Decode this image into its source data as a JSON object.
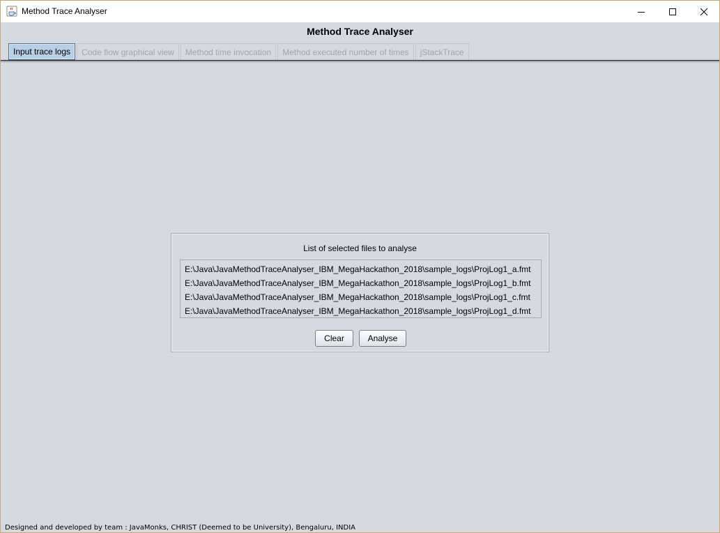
{
  "window": {
    "title": "Method Trace Analyser",
    "icon": "java-coffee-cup-icon",
    "controls": [
      "minimize-icon",
      "maximize-icon",
      "close-icon"
    ]
  },
  "app": {
    "heading": "Method Trace Analyser"
  },
  "tabs": [
    {
      "label": "Input trace logs",
      "active": true
    },
    {
      "label": "Code flow graphical view",
      "active": false
    },
    {
      "label": "Method time invocation",
      "active": false
    },
    {
      "label": "Method executed number of times",
      "active": false
    },
    {
      "label": "jStackTrace",
      "active": false
    }
  ],
  "panel": {
    "title": "List of selected files to analyse",
    "files": [
      "E:\\Java\\JavaMethodTraceAnalyser_IBM_MegaHackathon_2018\\sample_logs\\ProjLog1_a.fmt",
      "E:\\Java\\JavaMethodTraceAnalyser_IBM_MegaHackathon_2018\\sample_logs\\ProjLog1_b.fmt",
      "E:\\Java\\JavaMethodTraceAnalyser_IBM_MegaHackathon_2018\\sample_logs\\ProjLog1_c.fmt",
      "E:\\Java\\JavaMethodTraceAnalyser_IBM_MegaHackathon_2018\\sample_logs\\ProjLog1_d.fmt"
    ],
    "clear_label": "Clear",
    "analyse_label": "Analyse"
  },
  "footer": {
    "text": "Designed and developed by team : JavaMonks, CHRIST (Deemed to be University), Bengaluru, INDIA"
  },
  "colors": {
    "background": "#d6d9e0",
    "active_tab": "#b8cfe5",
    "inactive_tab_text": "#a1a4aa"
  }
}
